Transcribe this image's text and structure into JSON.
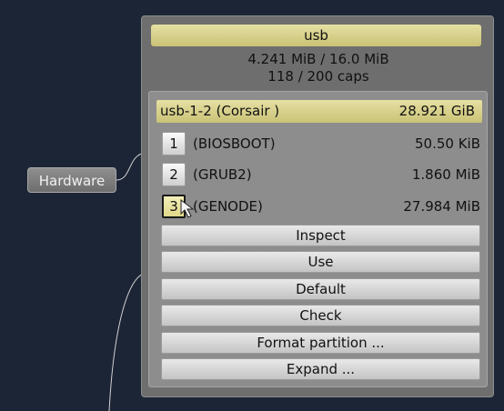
{
  "hardware_node": {
    "label": "Hardware"
  },
  "panel": {
    "title": "usb",
    "ram_usage": "4.241 MiB / 16.0 MiB",
    "caps_usage": "118 / 200 caps",
    "device": {
      "name": "usb-1-2 (Corsair )",
      "size": "28.921 GiB"
    },
    "partitions": [
      {
        "number": "1",
        "label": "(BIOSBOOT)",
        "size": "50.50 KiB"
      },
      {
        "number": "2",
        "label": "(GRUB2)",
        "size": "1.860 MiB"
      },
      {
        "number": "3",
        "label": "(GENODE)",
        "size": "27.984 MiB",
        "selected": true
      }
    ],
    "buttons": [
      "Inspect",
      "Use",
      "Default",
      "Check",
      "Format partition ...",
      "Expand ..."
    ]
  },
  "colors": {
    "background": "#1c2536",
    "highlight": "#e0d98f",
    "panel": "#6e6e6e"
  }
}
